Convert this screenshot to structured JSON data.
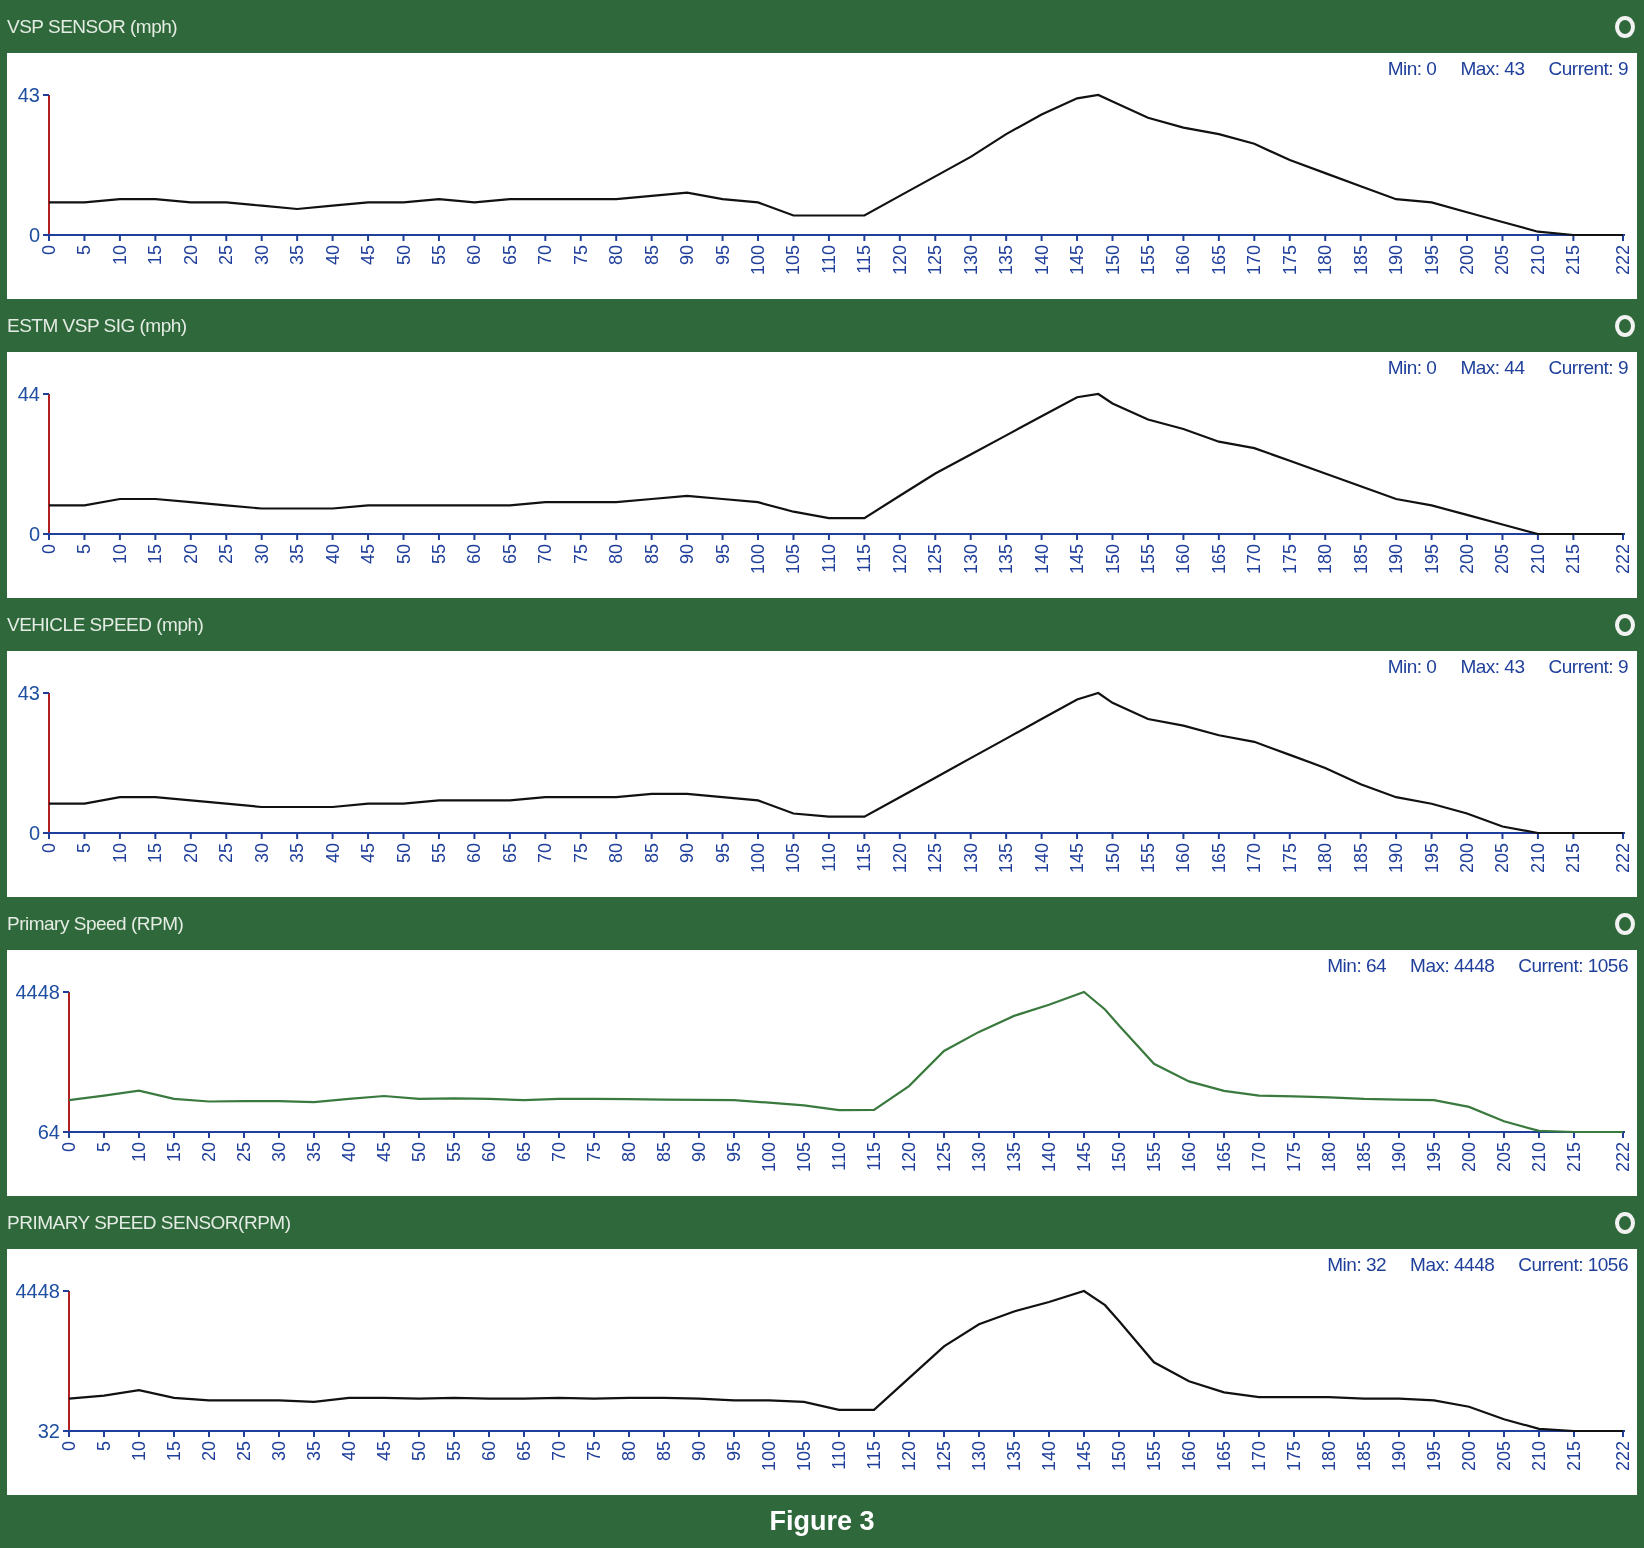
{
  "panels": [
    {
      "title": "VSP SENSOR (mph)",
      "min_label": "Min: 0",
      "max_label": "Max: 43",
      "current_label": "Current: 9",
      "chart_data": {
        "type": "line",
        "x": [
          0,
          5,
          10,
          15,
          20,
          25,
          30,
          35,
          40,
          45,
          50,
          55,
          60,
          65,
          70,
          75,
          80,
          85,
          90,
          95,
          100,
          105,
          110,
          115,
          120,
          125,
          130,
          135,
          140,
          145,
          148,
          150,
          155,
          160,
          165,
          170,
          175,
          180,
          185,
          190,
          195,
          200,
          205,
          210,
          215,
          222
        ],
        "xlim": [
          0,
          222
        ],
        "series": [
          {
            "color": "#111111",
            "values": [
              10,
              10,
              11,
              11,
              10,
              10,
              9,
              8,
              9,
              10,
              10,
              11,
              10,
              11,
              11,
              11,
              11,
              12,
              13,
              11,
              10,
              6,
              6,
              6,
              12,
              18,
              24,
              31,
              37,
              42,
              43,
              41,
              36,
              33,
              31,
              28,
              23,
              19,
              15,
              11,
              10,
              7,
              4,
              1,
              0,
              0
            ]
          }
        ],
        "ylim": [
          0,
          43
        ],
        "yticks": [
          {
            "value": 0,
            "label": "0"
          },
          {
            "value": 43,
            "label": "43"
          }
        ],
        "xticks": [
          0,
          5,
          10,
          15,
          20,
          25,
          30,
          35,
          40,
          45,
          50,
          55,
          60,
          65,
          70,
          75,
          80,
          85,
          90,
          95,
          100,
          105,
          110,
          115,
          120,
          125,
          130,
          135,
          140,
          145,
          150,
          155,
          160,
          165,
          170,
          175,
          180,
          185,
          190,
          195,
          200,
          205,
          210,
          215,
          222
        ]
      }
    },
    {
      "title": "ESTM VSP SIG (mph)",
      "min_label": "Min: 0",
      "max_label": "Max: 44",
      "current_label": "Current: 9",
      "chart_data": {
        "type": "line",
        "x": [
          0,
          5,
          10,
          15,
          20,
          25,
          30,
          35,
          40,
          45,
          50,
          55,
          60,
          65,
          70,
          75,
          80,
          85,
          90,
          95,
          100,
          105,
          110,
          115,
          120,
          125,
          130,
          135,
          140,
          145,
          148,
          150,
          155,
          160,
          165,
          170,
          175,
          180,
          185,
          190,
          195,
          200,
          205,
          210,
          215,
          222
        ],
        "xlim": [
          0,
          222
        ],
        "series": [
          {
            "color": "#111111",
            "values": [
              9,
              9,
              11,
              11,
              10,
              9,
              8,
              8,
              8,
              9,
              9,
              9,
              9,
              9,
              10,
              10,
              10,
              11,
              12,
              11,
              10,
              7,
              5,
              5,
              12,
              19,
              25,
              31,
              37,
              43,
              44,
              41,
              36,
              33,
              29,
              27,
              23,
              19,
              15,
              11,
              9,
              6,
              3,
              0,
              0,
              0
            ]
          }
        ],
        "ylim": [
          0,
          44
        ],
        "yticks": [
          {
            "value": 0,
            "label": "0"
          },
          {
            "value": 44,
            "label": "44"
          }
        ],
        "xticks": [
          0,
          5,
          10,
          15,
          20,
          25,
          30,
          35,
          40,
          45,
          50,
          55,
          60,
          65,
          70,
          75,
          80,
          85,
          90,
          95,
          100,
          105,
          110,
          115,
          120,
          125,
          130,
          135,
          140,
          145,
          150,
          155,
          160,
          165,
          170,
          175,
          180,
          185,
          190,
          195,
          200,
          205,
          210,
          215,
          222
        ]
      }
    },
    {
      "title": "VEHICLE SPEED (mph)",
      "min_label": "Min: 0",
      "max_label": "Max: 43",
      "current_label": "Current: 9",
      "chart_data": {
        "type": "line",
        "x": [
          0,
          5,
          10,
          15,
          20,
          25,
          30,
          35,
          40,
          45,
          50,
          55,
          60,
          65,
          70,
          75,
          80,
          85,
          90,
          95,
          100,
          105,
          110,
          115,
          120,
          125,
          130,
          135,
          140,
          145,
          148,
          150,
          155,
          160,
          165,
          170,
          175,
          180,
          185,
          190,
          195,
          200,
          205,
          210,
          215,
          222
        ],
        "xlim": [
          0,
          222
        ],
        "series": [
          {
            "color": "#111111",
            "values": [
              9,
              9,
              11,
              11,
              10,
              9,
              8,
              8,
              8,
              9,
              9,
              10,
              10,
              10,
              11,
              11,
              11,
              12,
              12,
              11,
              10,
              6,
              5,
              5,
              11,
              17,
              23,
              29,
              35,
              41,
              43,
              40,
              35,
              33,
              30,
              28,
              24,
              20,
              15,
              11,
              9,
              6,
              2,
              0,
              0,
              0
            ]
          }
        ],
        "ylim": [
          0,
          43
        ],
        "yticks": [
          {
            "value": 0,
            "label": "0"
          },
          {
            "value": 43,
            "label": "43"
          }
        ],
        "xticks": [
          0,
          5,
          10,
          15,
          20,
          25,
          30,
          35,
          40,
          45,
          50,
          55,
          60,
          65,
          70,
          75,
          80,
          85,
          90,
          95,
          100,
          105,
          110,
          115,
          120,
          125,
          130,
          135,
          140,
          145,
          150,
          155,
          160,
          165,
          170,
          175,
          180,
          185,
          190,
          195,
          200,
          205,
          210,
          215,
          222
        ]
      }
    },
    {
      "title": "Primary Speed (RPM)",
      "min_label": "Min: 64",
      "max_label": "Max: 4448",
      "current_label": "Current: 1056",
      "chart_data": {
        "type": "line",
        "x": [
          0,
          5,
          10,
          15,
          20,
          25,
          30,
          35,
          40,
          45,
          50,
          55,
          60,
          65,
          70,
          75,
          80,
          85,
          90,
          95,
          100,
          105,
          110,
          115,
          120,
          125,
          130,
          135,
          140,
          145,
          148,
          150,
          155,
          160,
          165,
          170,
          175,
          180,
          185,
          190,
          195,
          200,
          205,
          210,
          215,
          222
        ],
        "xlim": [
          0,
          222
        ],
        "series": [
          {
            "color": "#3a7a3e",
            "values": [
              1060,
              1200,
              1360,
              1100,
              1020,
              1030,
              1030,
              1000,
              1100,
              1190,
              1100,
              1120,
              1100,
              1060,
              1100,
              1100,
              1090,
              1080,
              1070,
              1060,
              980,
              900,
              750,
              760,
              1500,
              2600,
              3200,
              3700,
              4050,
              4448,
              3900,
              3400,
              2200,
              1650,
              1350,
              1200,
              1180,
              1150,
              1100,
              1080,
              1060,
              850,
              400,
              100,
              64,
              64
            ]
          }
        ],
        "ylim": [
          64,
          4448
        ],
        "yticks": [
          {
            "value": 64,
            "label": "64"
          },
          {
            "value": 4448,
            "label": "4448"
          }
        ],
        "xticks": [
          0,
          5,
          10,
          15,
          20,
          25,
          30,
          35,
          40,
          45,
          50,
          55,
          60,
          65,
          70,
          75,
          80,
          85,
          90,
          95,
          100,
          105,
          110,
          115,
          120,
          125,
          130,
          135,
          140,
          145,
          150,
          155,
          160,
          165,
          170,
          175,
          180,
          185,
          190,
          195,
          200,
          205,
          210,
          215,
          222
        ]
      }
    },
    {
      "title": "PRIMARY SPEED SENSOR(RPM)",
      "min_label": "Min: 32",
      "max_label": "Max: 4448",
      "current_label": "Current: 1056",
      "chart_data": {
        "type": "line",
        "x": [
          0,
          5,
          10,
          15,
          20,
          25,
          30,
          35,
          40,
          45,
          50,
          55,
          60,
          65,
          70,
          75,
          80,
          85,
          90,
          95,
          100,
          105,
          110,
          115,
          120,
          125,
          130,
          135,
          140,
          145,
          148,
          150,
          155,
          160,
          165,
          170,
          175,
          180,
          185,
          190,
          195,
          200,
          205,
          210,
          215,
          222
        ],
        "xlim": [
          0,
          222
        ],
        "series": [
          {
            "color": "#111111",
            "values": [
              1050,
              1150,
              1320,
              1080,
              1000,
              1000,
              1000,
              950,
              1080,
              1080,
              1050,
              1080,
              1050,
              1050,
              1080,
              1050,
              1080,
              1080,
              1050,
              1000,
              1000,
              950,
              700,
              700,
              1700,
              2700,
              3400,
              3800,
              4100,
              4448,
              4000,
              3500,
              2200,
              1600,
              1250,
              1100,
              1100,
              1100,
              1050,
              1050,
              1000,
              800,
              400,
              100,
              32,
              32
            ]
          }
        ],
        "ylim": [
          32,
          4448
        ],
        "yticks": [
          {
            "value": 32,
            "label": "32"
          },
          {
            "value": 4448,
            "label": "4448"
          }
        ],
        "xticks": [
          0,
          5,
          10,
          15,
          20,
          25,
          30,
          35,
          40,
          45,
          50,
          55,
          60,
          65,
          70,
          75,
          80,
          85,
          90,
          95,
          100,
          105,
          110,
          115,
          120,
          125,
          130,
          135,
          140,
          145,
          150,
          155,
          160,
          165,
          170,
          175,
          180,
          185,
          190,
          195,
          200,
          205,
          210,
          215,
          222
        ]
      }
    }
  ],
  "caption": "Figure 3"
}
